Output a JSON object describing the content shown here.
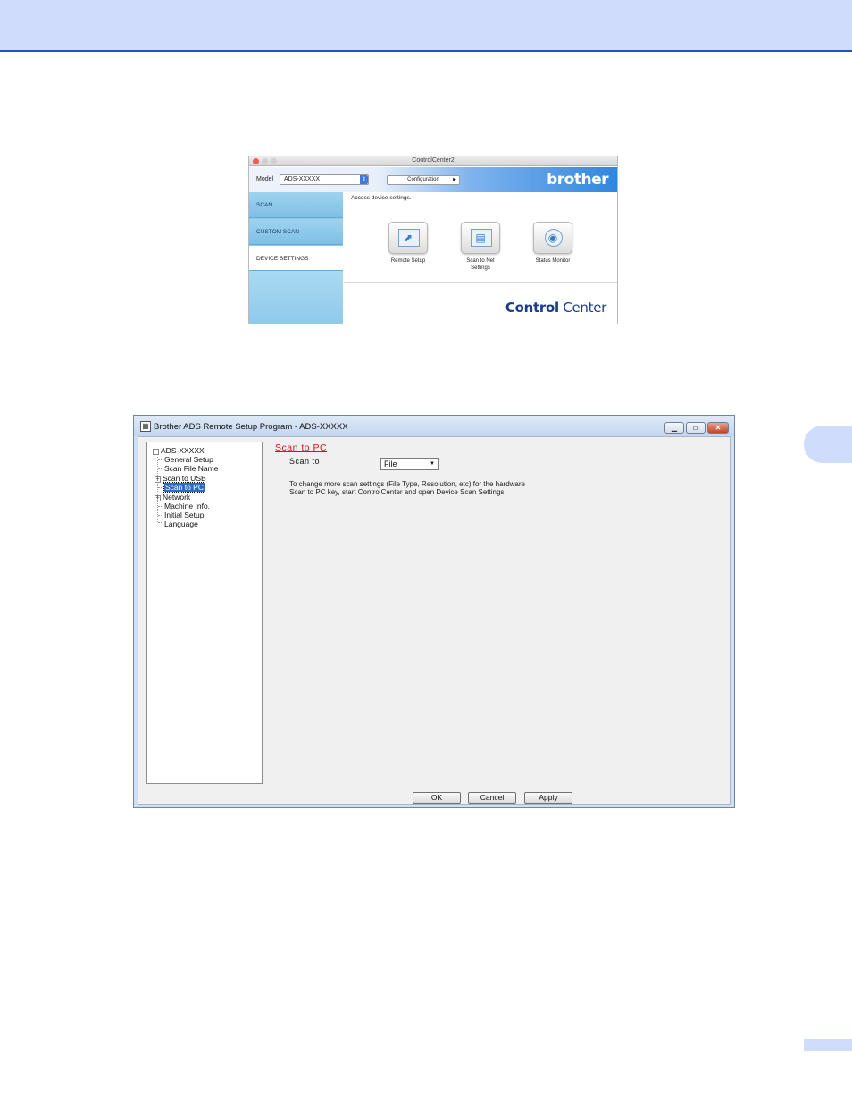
{
  "control_center": {
    "window_title": "ControlCenter2",
    "model_label": "Model",
    "model_value": "ADS-XXXXX",
    "configuration_label": "Configuration",
    "brand_logo": "brother",
    "tabs": [
      {
        "label": "SCAN"
      },
      {
        "label": "CUSTOM SCAN"
      },
      {
        "label": "DEVICE SETTINGS"
      }
    ],
    "message": "Access device settings.",
    "buttons": [
      {
        "label": "Remote Setup",
        "icon": "remote-setup-icon"
      },
      {
        "label": "Scan to Net Settings",
        "icon": "scan-to-net-icon"
      },
      {
        "label": "Status Monitor",
        "icon": "status-monitor-icon"
      }
    ],
    "footer_logo_bold": "Control",
    "footer_logo_light": " Center"
  },
  "remote_setup": {
    "window_title": "Brother ADS Remote Setup Program - ADS-XXXXX",
    "tree": {
      "root": "ADS-XXXXX",
      "items": [
        {
          "label": "General Setup"
        },
        {
          "label": "Scan File Name"
        },
        {
          "label": "Scan to USB"
        },
        {
          "label": "Scan to PC"
        },
        {
          "label": "Network"
        },
        {
          "label": "Machine Info."
        },
        {
          "label": "Initial Setup"
        },
        {
          "label": "Language"
        }
      ]
    },
    "section_title": "Scan to PC",
    "scan_to_label": "Scan to",
    "scan_to_value": "File",
    "note_line1": "To change more scan settings (File Type, Resolution, etc) for the hardware",
    "note_line2": "Scan to PC key, start ControlCenter and open Device Scan Settings.",
    "ok_label": "OK",
    "cancel_label": "Cancel",
    "apply_label": "Apply"
  },
  "colors": {
    "header_band": "#cfdcfb",
    "header_rule": "#2453b8",
    "section_title": "#d4141a"
  }
}
